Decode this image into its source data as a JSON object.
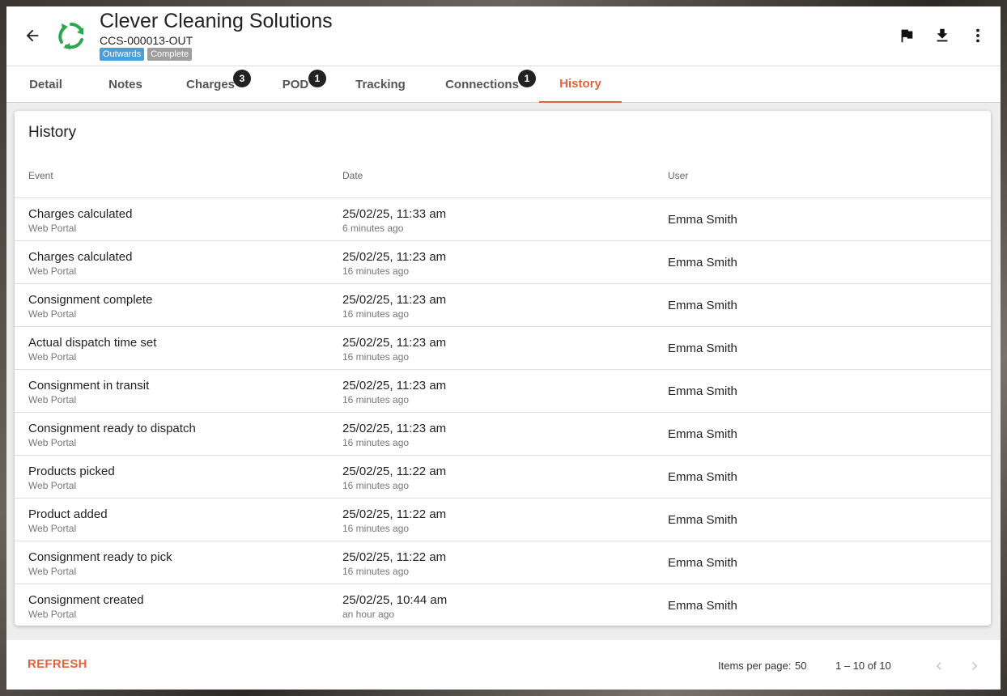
{
  "header": {
    "title": "Clever Cleaning Solutions",
    "subtitle": "CCS-000013-OUT",
    "badges": [
      "Outwards",
      "Complete"
    ],
    "logo_color": "#2aa84a"
  },
  "tabs": [
    {
      "label": "Detail"
    },
    {
      "label": "Notes"
    },
    {
      "label": "Charges",
      "badge": "3"
    },
    {
      "label": "POD",
      "badge": "1"
    },
    {
      "label": "Tracking"
    },
    {
      "label": "Connections",
      "badge": "1"
    },
    {
      "label": "History",
      "active": true
    }
  ],
  "history": {
    "title": "History",
    "columns": [
      "Event",
      "Date",
      "User"
    ],
    "rows": [
      {
        "event": "Charges calculated",
        "source": "Web Portal",
        "date": "25/02/25, 11:33 am",
        "ago": "6 minutes ago",
        "user": "Emma Smith"
      },
      {
        "event": "Charges calculated",
        "source": "Web Portal",
        "date": "25/02/25, 11:23 am",
        "ago": "16 minutes ago",
        "user": "Emma Smith"
      },
      {
        "event": "Consignment complete",
        "source": "Web Portal",
        "date": "25/02/25, 11:23 am",
        "ago": "16 minutes ago",
        "user": "Emma Smith"
      },
      {
        "event": "Actual dispatch time set",
        "source": "Web Portal",
        "date": "25/02/25, 11:23 am",
        "ago": "16 minutes ago",
        "user": "Emma Smith"
      },
      {
        "event": "Consignment in transit",
        "source": "Web Portal",
        "date": "25/02/25, 11:23 am",
        "ago": "16 minutes ago",
        "user": "Emma Smith"
      },
      {
        "event": "Consignment ready to dispatch",
        "source": "Web Portal",
        "date": "25/02/25, 11:23 am",
        "ago": "16 minutes ago",
        "user": "Emma Smith"
      },
      {
        "event": "Products picked",
        "source": "Web Portal",
        "date": "25/02/25, 11:22 am",
        "ago": "16 minutes ago",
        "user": "Emma Smith"
      },
      {
        "event": "Product added",
        "source": "Web Portal",
        "date": "25/02/25, 11:22 am",
        "ago": "16 minutes ago",
        "user": "Emma Smith"
      },
      {
        "event": "Consignment ready to pick",
        "source": "Web Portal",
        "date": "25/02/25, 11:22 am",
        "ago": "16 minutes ago",
        "user": "Emma Smith"
      },
      {
        "event": "Consignment created",
        "source": "Web Portal",
        "date": "25/02/25, 10:44 am",
        "ago": "an hour ago",
        "user": "Emma Smith"
      }
    ]
  },
  "footer": {
    "refresh_label": "REFRESH",
    "items_per_page_label": "Items per page:",
    "items_per_page": "50",
    "range": "1 – 10 of 10"
  },
  "icons": {
    "back": "arrow-back-icon",
    "flag": "flag-icon",
    "download": "download-icon",
    "menu": "more-vert-icon",
    "prev": "chevron-left-icon",
    "next": "chevron-right-icon"
  },
  "colors": {
    "accent": "#e0643a",
    "outwards_badge": "#4a9fd9",
    "complete_badge": "#9e9e9e"
  }
}
